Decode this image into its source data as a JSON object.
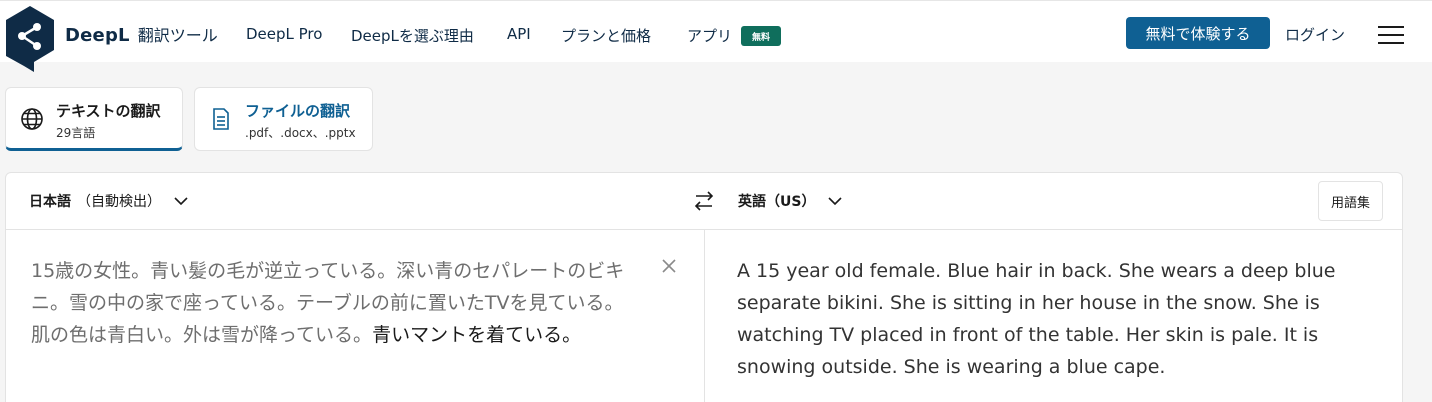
{
  "header": {
    "brand_name": "DeepL",
    "brand_sub": "翻訳ツール",
    "nav": [
      "DeepL Pro",
      "DeepLを選ぶ理由",
      "API",
      "プランと価格",
      "アプリ"
    ],
    "app_badge": "無料",
    "cta": "無料で体験する",
    "login": "ログイン",
    "menu_icon": "hamburger-icon",
    "colors": {
      "brand": "#0f2b46",
      "cta": "#0f6093",
      "badge": "#0f6e5c"
    }
  },
  "modes": [
    {
      "title": "テキストの翻訳",
      "sub": "29言語",
      "icon": "globe-icon",
      "active": true
    },
    {
      "title": "ファイルの翻訳",
      "sub": ".pdf、.docx、.pptx",
      "icon": "document-icon",
      "active": false
    }
  ],
  "translator": {
    "source_lang": "日本語",
    "source_note": "（自動検出）",
    "target_lang": "英語（US）",
    "glossary": "用語集",
    "source_text_main": "15歳の女性。青い髪の毛が逆立っている。深い青のセパレートのビキニ。雪の中の家で座っている。テーブルの前に置いたTVを見ている。肌の色は青白い。外は雪が降っている。",
    "source_text_highlight": "青いマントを着ている。",
    "target_text": "A 15 year old female. Blue hair in back. She wears a deep blue separate bikini. She is sitting in her house in the snow. She is watching TV placed in front of the table. Her skin is pale. It is snowing outside. She is wearing a blue cape."
  }
}
